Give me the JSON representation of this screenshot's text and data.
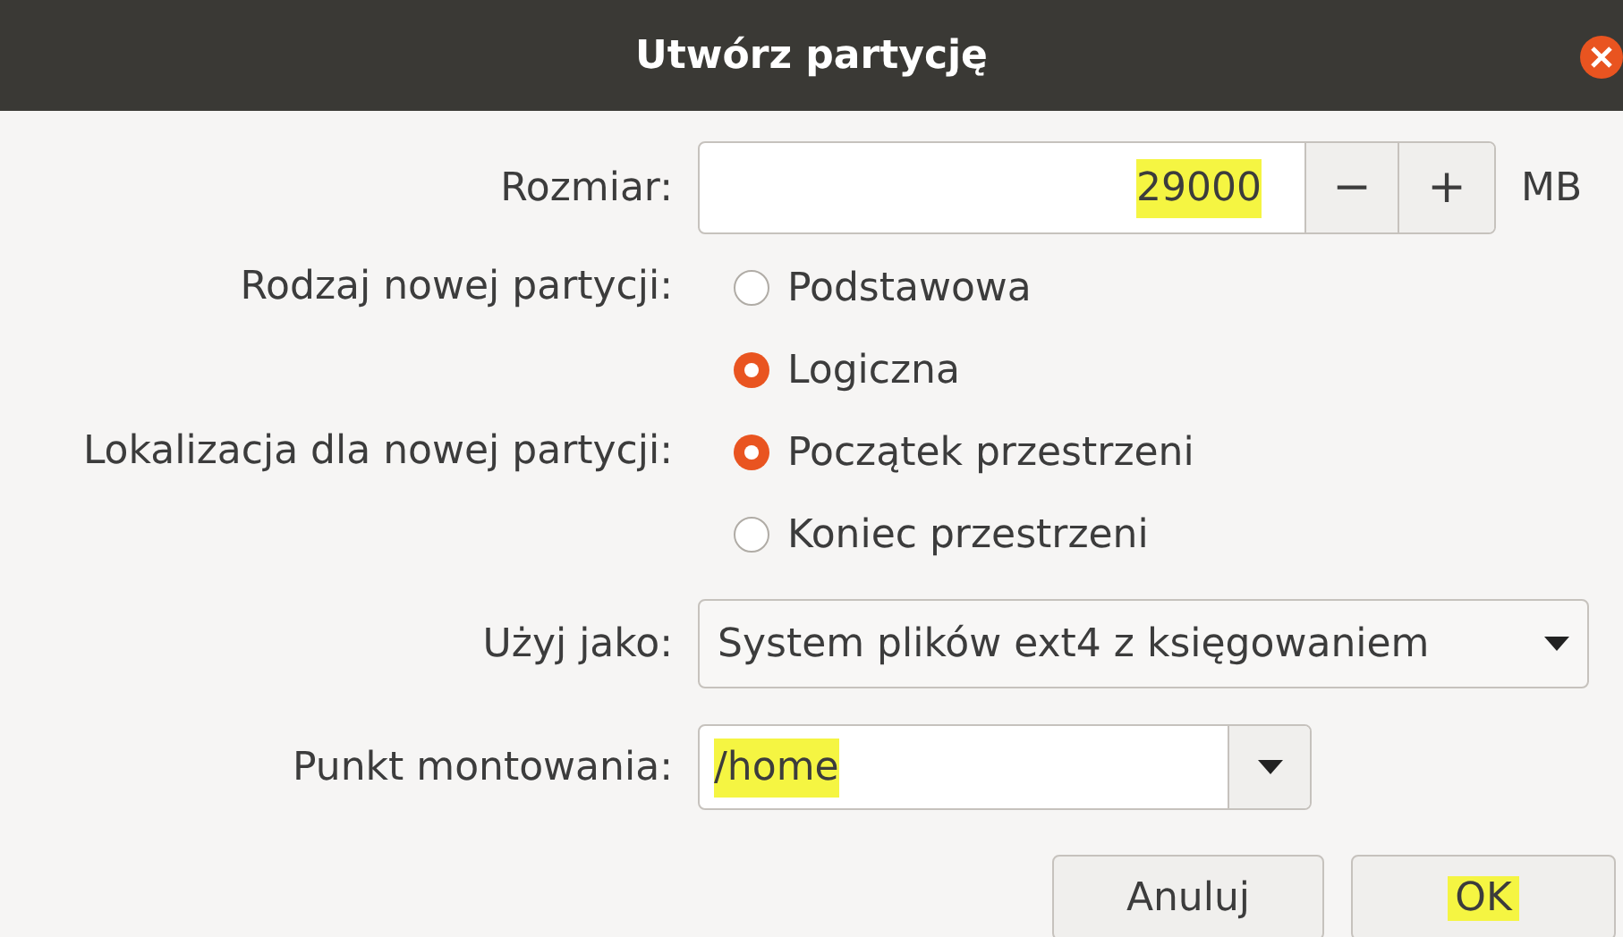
{
  "window": {
    "title": "Utwórz partycję"
  },
  "size": {
    "label": "Rozmiar:",
    "value": "29000",
    "highlighted": true,
    "minus": "−",
    "plus": "+",
    "unit": "MB"
  },
  "type": {
    "label": "Rodzaj nowej partycji:",
    "options": [
      {
        "label": "Podstawowa",
        "selected": false
      },
      {
        "label": "Logiczna",
        "selected": true
      }
    ]
  },
  "location": {
    "label": "Lokalizacja dla nowej partycji:",
    "options": [
      {
        "label": "Początek przestrzeni",
        "selected": true
      },
      {
        "label": "Koniec przestrzeni",
        "selected": false
      }
    ]
  },
  "use_as": {
    "label": "Użyj jako:",
    "value": "System plików ext4 z księgowaniem"
  },
  "mount_point": {
    "label": "Punkt montowania:",
    "value": "/home",
    "highlighted": true
  },
  "buttons": [
    {
      "label": "Anuluj",
      "highlighted": false
    },
    {
      "label": "OK",
      "highlighted": true
    }
  ]
}
